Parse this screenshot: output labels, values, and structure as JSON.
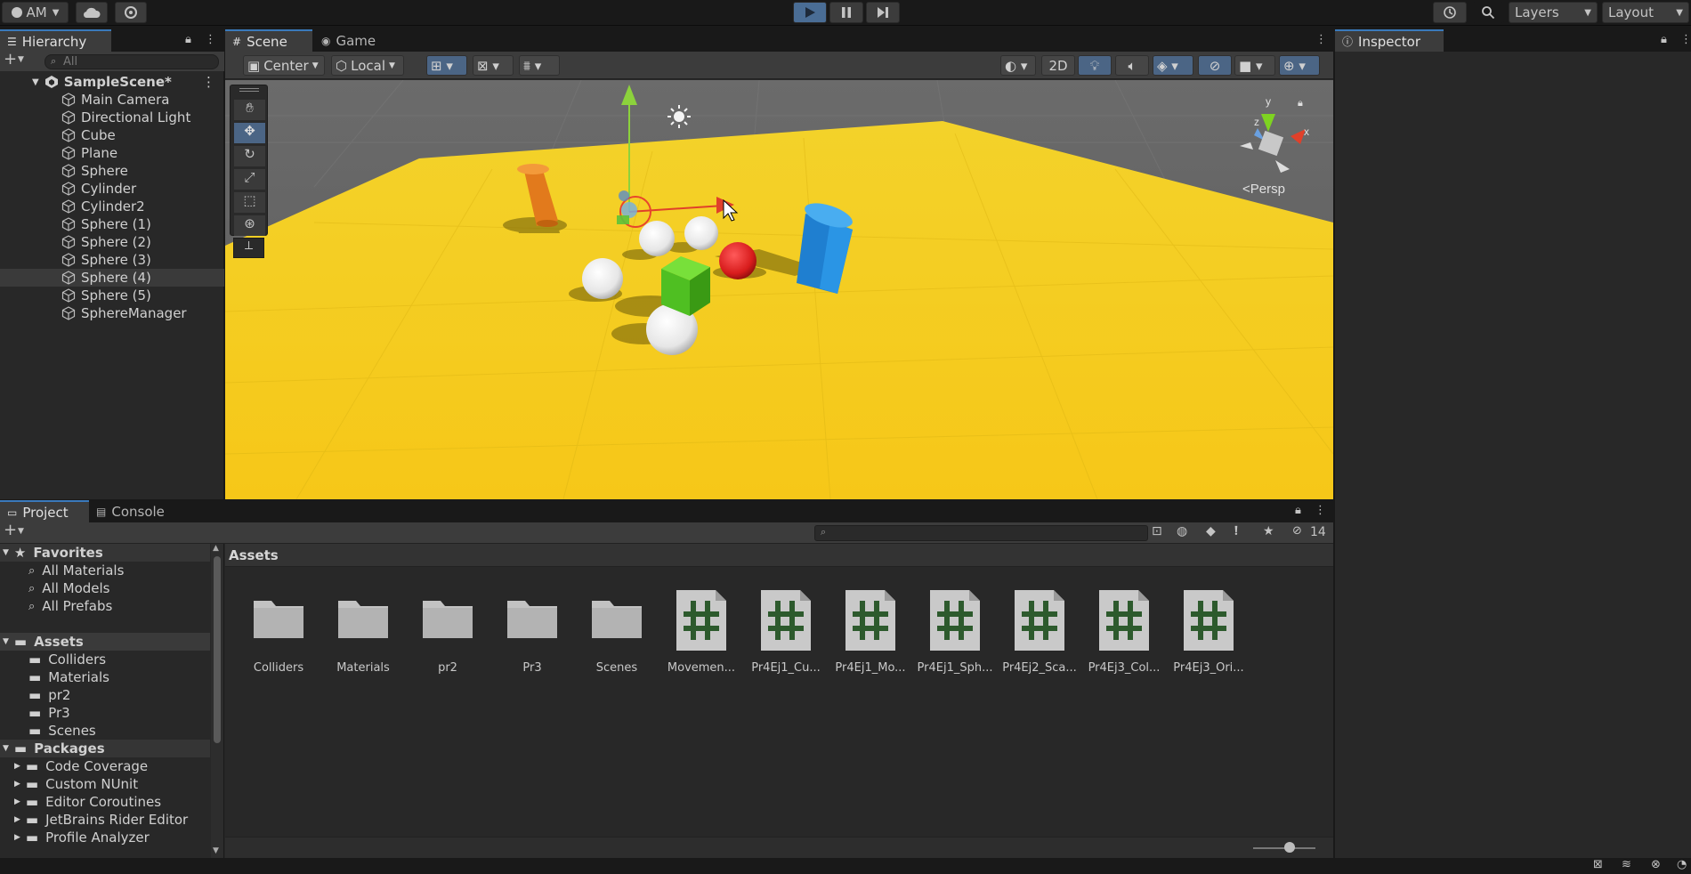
{
  "topbar": {
    "account_label": "AM",
    "layers_label": "Layers",
    "layout_label": "Layout"
  },
  "hierarchy": {
    "tab": "Hierarchy",
    "search_placeholder": "All",
    "scene_name": "SampleScene*",
    "items": [
      "Main Camera",
      "Directional Light",
      "Cube",
      "Plane",
      "Sphere",
      "Cylinder",
      "Cylinder2",
      "Sphere (1)",
      "Sphere (2)",
      "Sphere (3)",
      "Sphere (4)",
      "Sphere (5)",
      "SphereManager"
    ],
    "selected_index": 10
  },
  "scene": {
    "tabs": [
      "Scene",
      "Game"
    ],
    "pivot_label": "Center",
    "space_label": "Local",
    "mode_2d_label": "2D",
    "persp_label": "<Persp",
    "axis_labels": {
      "x": "x",
      "y": "y",
      "z": "z"
    }
  },
  "inspector": {
    "tab": "Inspector"
  },
  "project": {
    "tabs": [
      "Project",
      "Console"
    ],
    "hidden_count": "14",
    "breadcrumb": "Assets",
    "favorites_header": "Favorites",
    "favorites": [
      "All Materials",
      "All Models",
      "All Prefabs"
    ],
    "assets_header": "Assets",
    "asset_folders": [
      "Colliders",
      "Materials",
      "pr2",
      "Pr3",
      "Scenes"
    ],
    "packages_header": "Packages",
    "packages": [
      "Code Coverage",
      "Custom NUnit",
      "Editor Coroutines",
      "JetBrains Rider Editor",
      "Profile Analyzer"
    ],
    "grid_items": [
      {
        "label": "Colliders",
        "type": "folder"
      },
      {
        "label": "Materials",
        "type": "folder"
      },
      {
        "label": "pr2",
        "type": "folder"
      },
      {
        "label": "Pr3",
        "type": "folder"
      },
      {
        "label": "Scenes",
        "type": "folder"
      },
      {
        "label": "Movemen...",
        "type": "script"
      },
      {
        "label": "Pr4Ej1_Cu...",
        "type": "script"
      },
      {
        "label": "Pr4Ej1_Mo...",
        "type": "script"
      },
      {
        "label": "Pr4Ej1_Sph...",
        "type": "script"
      },
      {
        "label": "Pr4Ej2_Sca...",
        "type": "script"
      },
      {
        "label": "Pr4Ej3_Col...",
        "type": "script"
      },
      {
        "label": "Pr4Ej3_Ori...",
        "type": "script"
      }
    ]
  },
  "colors": {
    "accent": "#3a79bb",
    "panel": "#282828",
    "ground": "#f5d51e",
    "script_icon": "#2d5a2d"
  }
}
